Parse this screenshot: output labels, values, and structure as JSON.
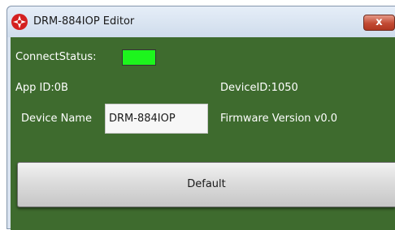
{
  "window": {
    "title": "DRM-884IOP Editor",
    "close_glyph": "x",
    "icon": "app-logo-icon",
    "accent_color": "#3e6b2e"
  },
  "connection": {
    "label": "ConnectStatus:",
    "status_color": "#1df51d"
  },
  "info": {
    "app_id": "App ID:0B",
    "device_id": "DeviceID:1050",
    "device_name_label": "Device Name",
    "device_name_value": "DRM-884IOP",
    "firmware_version": "Firmware Version  v0.0"
  },
  "actions": {
    "default_label": "Default"
  }
}
